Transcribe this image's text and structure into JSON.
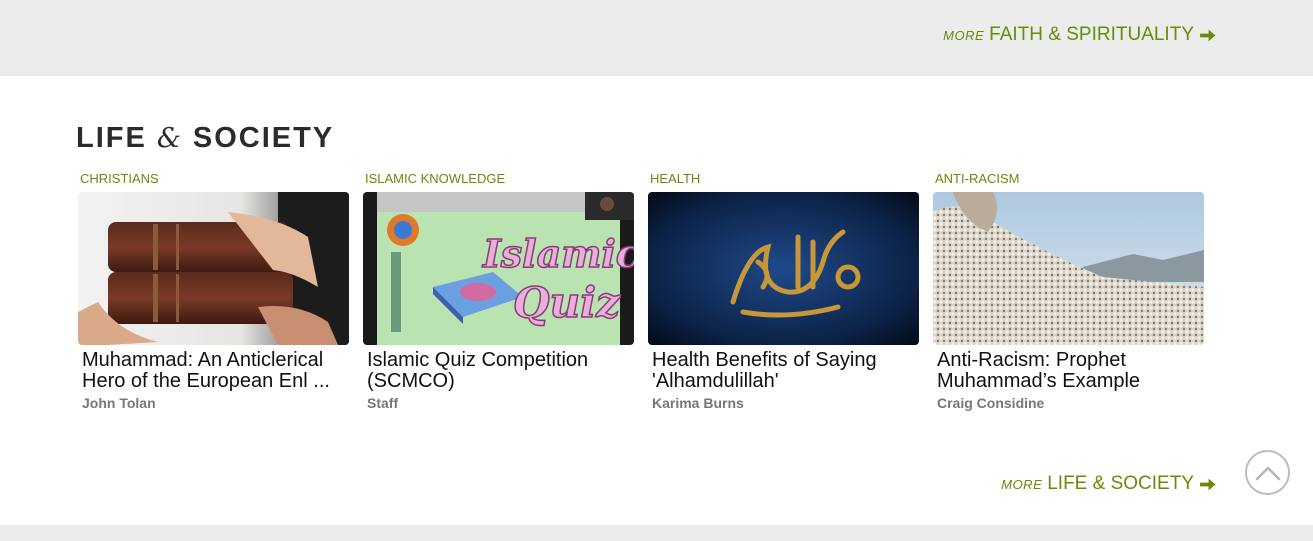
{
  "top_more": {
    "more": "MORE",
    "category": "FAITH & SPIRITUALITY"
  },
  "section": {
    "title_part1": "LIFE",
    "title_amp": "&",
    "title_part2": "SOCIETY"
  },
  "cards": [
    {
      "category": "CHRISTIANS",
      "title": "Muhammad: An Anticlerical Hero of the European Enl ...",
      "author": "John Tolan",
      "image": "books-held-in-hands"
    },
    {
      "category": "ISLAMIC KNOWLEDGE",
      "title": "Islamic Quiz Competition (SCMCO)",
      "author": "Staff",
      "image": "islamic-quiz-graphic"
    },
    {
      "category": "HEALTH",
      "title": "Health Benefits of Saying 'Alhamdulillah'",
      "author": "Karima Burns",
      "image": "alhamdulillah-calligraphy"
    },
    {
      "category": "ANTI-RACISM",
      "title": "Anti-Racism: Prophet Muhammad’s Example",
      "author": "Craig Considine",
      "image": "pilgrims-on-mount-arafat"
    }
  ],
  "bottom_more": {
    "more": "MORE",
    "category": "LIFE & SOCIETY"
  },
  "colors": {
    "accent": "#6a8a0a",
    "band": "#ececec",
    "title": "#2b2b2b"
  },
  "icons": {
    "arrow": "arrow-right-icon",
    "scroll_top": "chevron-up-icon"
  }
}
